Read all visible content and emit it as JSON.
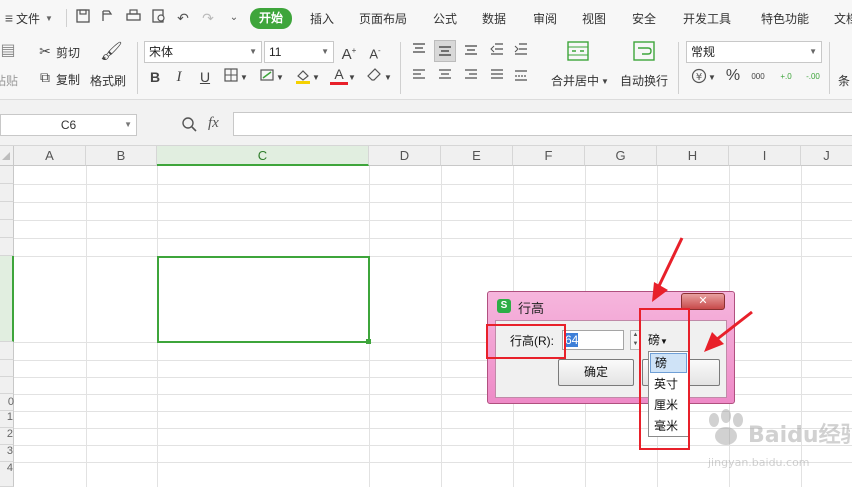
{
  "menubar": {
    "file": "文件",
    "tabs": [
      "开始",
      "插入",
      "页面布局",
      "公式",
      "数据",
      "审阅",
      "视图",
      "安全",
      "开发工具",
      "特色功能",
      "文档"
    ],
    "active_tab": "开始"
  },
  "ribbon": {
    "paste_label": "粘贴",
    "cut_label": "剪切",
    "copy_label": "复制",
    "format_painter_label": "格式刷",
    "font_name": "宋体",
    "font_size": "11",
    "merge_label": "合并居中",
    "wrap_label": "自动换行",
    "number_format": "常规",
    "cond_label": "条",
    "icons": {
      "bold": "B",
      "italic": "I",
      "underline": "U",
      "font_grow": "A⁺",
      "font_shrink": "A⁻",
      "currency": "¥",
      "percent": "%",
      "thousands": "000",
      "inc_decimal": "+.0",
      "dec_decimal": "-.00"
    }
  },
  "formulabar": {
    "name_box": "C6",
    "fx_label": "fx",
    "formula_value": ""
  },
  "grid": {
    "columns": [
      "A",
      "B",
      "C",
      "D",
      "E",
      "F",
      "G",
      "H",
      "I",
      "J"
    ],
    "selected_column": "C",
    "row_labels": [
      "",
      "",
      "",
      "",
      "",
      "",
      "",
      "",
      "",
      "",
      "0",
      "1",
      "2",
      "3",
      "4"
    ],
    "selected_cell": "C6",
    "selection_color": "#3ea53b"
  },
  "dialog": {
    "title": "行高",
    "icon_glyph": "S",
    "close_glyph": "✕",
    "label": "行高(R):",
    "value": "64",
    "unit": "磅",
    "ok_label": "确定",
    "cancel_label": "",
    "unit_options": [
      "磅",
      "英寸",
      "厘米",
      "毫米"
    ],
    "highlighted_option": "磅"
  },
  "annotation": {
    "color": "#e8202a"
  },
  "watermark": {
    "text": "Baidu经验",
    "url": "jingyan.baidu.com"
  }
}
